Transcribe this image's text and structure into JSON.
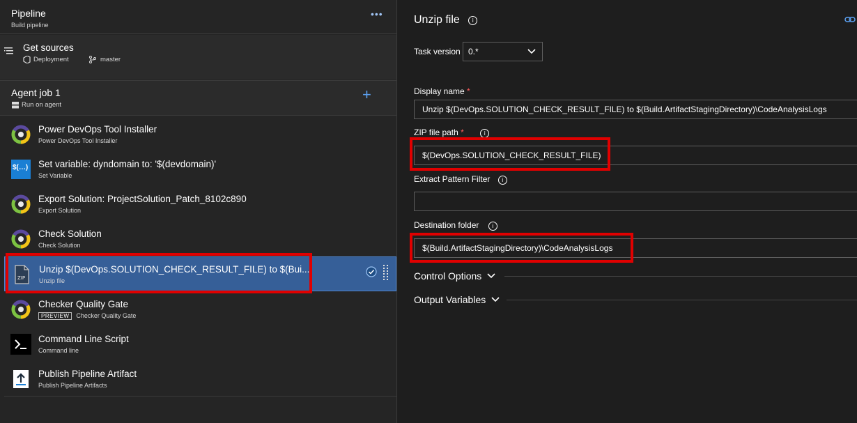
{
  "pipeline": {
    "title": "Pipeline",
    "subtitle": "Build pipeline",
    "more": "•••"
  },
  "get_sources": {
    "title": "Get sources",
    "repo": "Deployment",
    "branch": "master"
  },
  "agent_job": {
    "title": "Agent job 1",
    "subtitle": "Run on agent",
    "add": "+"
  },
  "tasks": [
    {
      "title": "Power DevOps Tool Installer",
      "subtitle": "Power DevOps Tool Installer",
      "icon": "power-devops-icon"
    },
    {
      "title": "Set variable: dyndomain to: '$(devdomain)'",
      "subtitle": "Set Variable",
      "icon": "set-variable-icon",
      "icon_text": "$(…)"
    },
    {
      "title": "Export Solution: ProjectSolution_Patch_8102c890",
      "subtitle": "Export Solution",
      "icon": "power-devops-icon"
    },
    {
      "title": "Check Solution",
      "subtitle": "Check Solution",
      "icon": "power-devops-icon"
    },
    {
      "title": "Unzip $(DevOps.SOLUTION_CHECK_RESULT_FILE) to $(Bui...",
      "subtitle": "Unzip file",
      "icon": "zip-file-icon",
      "icon_text": "ZIP",
      "selected": true
    },
    {
      "title": "Checker Quality Gate",
      "subtitle": "Checker Quality Gate",
      "badge": "PREVIEW",
      "icon": "power-devops-icon"
    },
    {
      "title": "Command Line Script",
      "subtitle": "Command line",
      "icon": "terminal-icon"
    },
    {
      "title": "Publish Pipeline Artifact",
      "subtitle": "Publish Pipeline Artifacts",
      "icon": "upload-artifact-icon"
    }
  ],
  "detail": {
    "title": "Unzip file",
    "task_version_label": "Task version",
    "task_version_value": "0.*",
    "display_name_label": "Display name",
    "display_name_value": "Unzip $(DevOps.SOLUTION_CHECK_RESULT_FILE) to $(Build.ArtifactStagingDirectory)\\CodeAnalysisLogs",
    "zip_path_label": "ZIP file path",
    "zip_path_value": "$(DevOps.SOLUTION_CHECK_RESULT_FILE)",
    "extract_filter_label": "Extract Pattern Filter",
    "extract_filter_value": "",
    "dest_folder_label": "Destination folder",
    "dest_folder_value": "$(Build.ArtifactStagingDirectory)\\CodeAnalysisLogs",
    "required_marker": "*",
    "info_glyph": "i",
    "control_options": "Control Options",
    "output_variables": "Output Variables"
  },
  "colors": {
    "accent": "#5ca1f2",
    "selected": "#365f98",
    "highlight": "#e00000"
  }
}
